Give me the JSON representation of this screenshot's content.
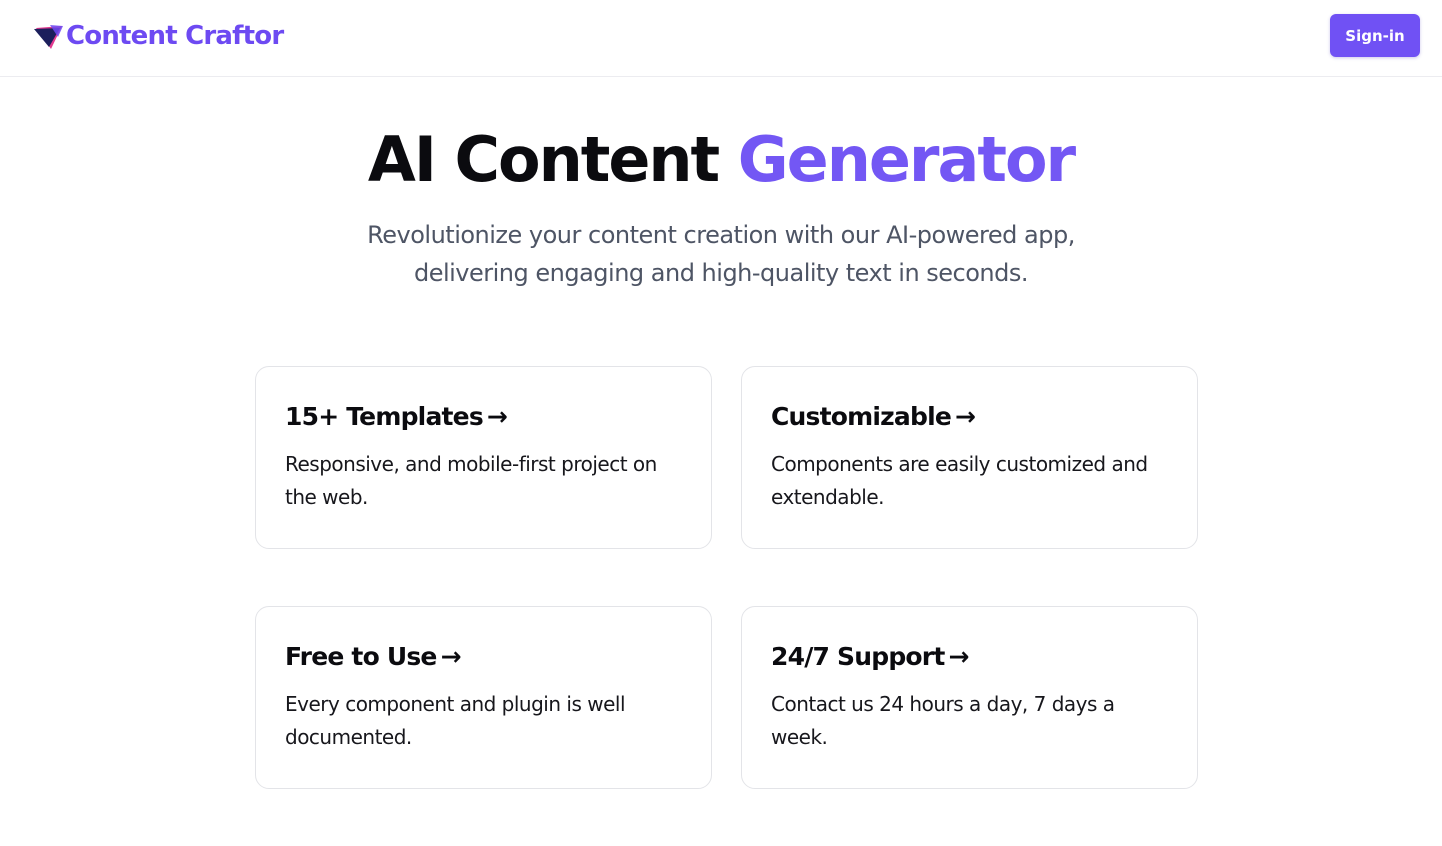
{
  "header": {
    "brand_name": "Content Craftor",
    "logo_icon": "triangle-logo-icon",
    "signin_label": "Sign-in"
  },
  "hero": {
    "title_main": "AI Content",
    "title_accent": "Generator",
    "subtitle": "Revolutionize your content creation with our AI-powered app, delivering engaging and high-quality text in seconds."
  },
  "features": [
    {
      "title": "15+ Templates",
      "arrow": "→",
      "description": "Responsive, and mobile-first project on the web."
    },
    {
      "title": "Customizable",
      "arrow": "→",
      "description": "Components are easily customized and extendable."
    },
    {
      "title": "Free to Use",
      "arrow": "→",
      "description": "Every component and plugin is well documented."
    },
    {
      "title": "24/7 Support",
      "arrow": "→",
      "description": "Contact us 24 hours a day, 7 days a week."
    }
  ],
  "colors": {
    "accent": "#7357f4",
    "button": "#7051f4",
    "logo_dark": "#1c1f5c",
    "logo_pink": "#e23a8f"
  }
}
